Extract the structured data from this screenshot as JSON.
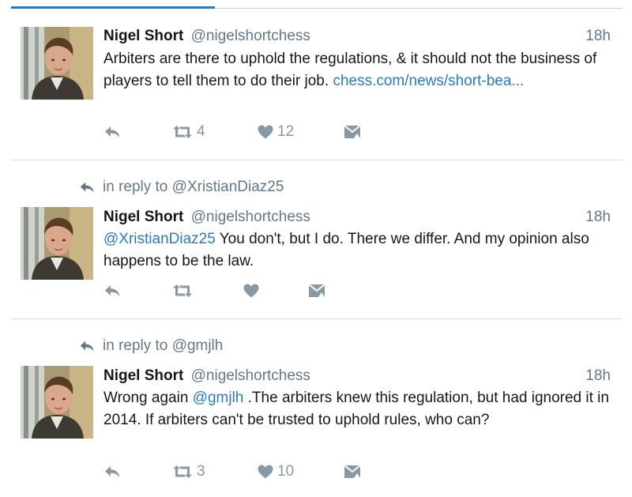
{
  "colors": {
    "link": "#2b7bb9",
    "secondary_text": "#657786",
    "action_icon": "#8899a6",
    "divider": "#d6dee4"
  },
  "icons": {
    "reply": "reply-arrow-icon",
    "retweet": "retweet-icon",
    "like": "heart-icon",
    "message": "envelope-icon"
  },
  "tweets": [
    {
      "reply_to": "",
      "name": "Nigel Short",
      "handle": "@nigelshortchess",
      "time": "18h",
      "text_before": "Arbiters are there to uphold the regulations, & it should not the business of players to tell them to do their job. ",
      "link": "chess.com/news/short-bea...",
      "text_after": "",
      "retweets": "4",
      "likes": "12"
    },
    {
      "reply_to": "in reply to @XristianDiaz25",
      "name": "Nigel Short",
      "handle": "@nigelshortchess",
      "time": "18h",
      "text_before": "",
      "link": "@XristianDiaz25",
      "text_after": " You don't, but I do. There we differ. And my opinion also happens to be the law.",
      "retweets": "",
      "likes": ""
    },
    {
      "reply_to": "in reply to @gmjlh",
      "name": "Nigel Short",
      "handle": "@nigelshortchess",
      "time": "18h",
      "text_before": "Wrong again ",
      "link": "@gmjlh",
      "text_after": " .The arbiters knew this regulation, but had ignored it in 2014. If arbiters can't be trusted to uphold rules, who can?",
      "retweets": "3",
      "likes": "10"
    }
  ]
}
